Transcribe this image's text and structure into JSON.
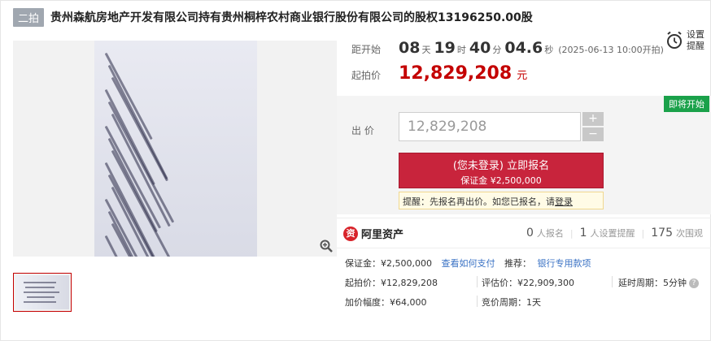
{
  "header": {
    "tag": "二拍",
    "title": "贵州森航房地产开发有限公司持有贵州桐梓农村商业银行股份有限公司的股权13196250.00股"
  },
  "countdown": {
    "label": "距开始",
    "days": "08",
    "day_unit": "天",
    "hours": "19",
    "hour_unit": "时",
    "minutes": "40",
    "minute_unit": "分",
    "seconds": "04.6",
    "second_unit": "秒",
    "start_time": "(2025-06-13 10:00开拍)"
  },
  "reminder": {
    "line1": "设置",
    "line2": "提醒",
    "icon": "alarm-clock-icon"
  },
  "start_price": {
    "label": "起拍价",
    "value": "12,829,208",
    "unit": "元"
  },
  "bid": {
    "status_badge": "即将开始",
    "label": "出 价",
    "input_value": "12,829,208",
    "plus": "+",
    "minus": "−",
    "apply_line1": "(您未登录) 立即报名",
    "apply_line2": "保证金 ¥2,500,000",
    "tip_prefix": "提醒：先报名再出价。如您已报名，请",
    "tip_link": "登录"
  },
  "platform": {
    "name": "阿里资产",
    "logo_char": "资"
  },
  "stats": {
    "applicants_num": "0",
    "applicants_label": "人报名",
    "reminders_num": "1",
    "reminders_label": "人设置提醒",
    "views_num": "175",
    "views_label": "次围观"
  },
  "details": {
    "deposit": "保证金：¥2,500,000",
    "how_to_pay": "查看如何支付",
    "recommend_label": "推荐：",
    "bank_loan": "银行专用款项",
    "start_price": "起拍价：¥12,829,208",
    "appraisal": "评估价：¥22,909,300",
    "delay": "延时周期：5分钟",
    "increment": "加价幅度：¥64,000",
    "auction_period": "竞价周期：1天"
  },
  "colors": {
    "accent_red": "#c40000",
    "button_red": "#c8243c",
    "badge_green": "#1aa14a",
    "link_blue": "#3a72c4"
  }
}
